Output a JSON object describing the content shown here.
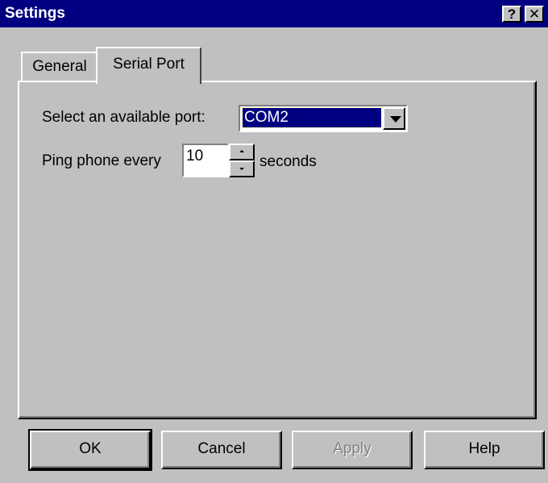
{
  "window": {
    "title": "Settings",
    "help_button": "?",
    "close_button": "✕"
  },
  "tabs": [
    {
      "label": "General",
      "active": false
    },
    {
      "label": "Serial Port",
      "active": true
    }
  ],
  "serial_port": {
    "port_label": "Select an available port:",
    "port_value": "COM2",
    "ping_label": "Ping phone every",
    "ping_value": "10",
    "seconds_label": "seconds"
  },
  "buttons": {
    "ok": "OK",
    "cancel": "Cancel",
    "apply": "Apply",
    "help": "Help"
  },
  "colors": {
    "titlebar": "#000080",
    "face": "#c0c0c0",
    "selection": "#000080"
  }
}
